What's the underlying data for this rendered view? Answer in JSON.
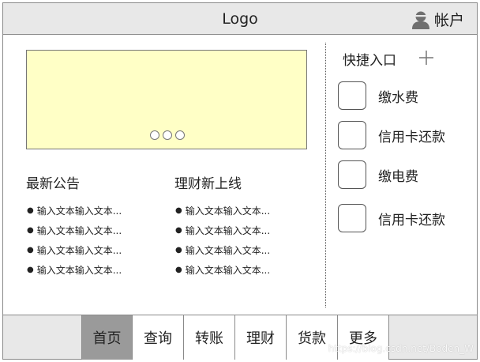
{
  "header": {
    "logo": "Logo",
    "account_label": "帐户",
    "account_icon": "user-icon"
  },
  "banner": {
    "indicator_count": 3
  },
  "news": {
    "title": "最新公告",
    "items": [
      "输入文本输入文本...",
      "输入文本输入文本...",
      "输入文本输入文本...",
      "输入文本输入文本..."
    ]
  },
  "finance": {
    "title": "理财新上线",
    "items": [
      "输入文本输入文本...",
      "输入文本输入文本...",
      "输入文本输入文本...",
      "输入文本输入文本..."
    ]
  },
  "quick": {
    "title": "快捷入口",
    "add_icon": "plus-icon",
    "items": [
      {
        "label": "缴水费"
      },
      {
        "label": "信用卡还款"
      },
      {
        "label": "缴电费"
      },
      {
        "label": "信用卡还款"
      }
    ]
  },
  "nav": {
    "tabs": [
      {
        "label": "首页",
        "active": true
      },
      {
        "label": "查询",
        "active": false
      },
      {
        "label": "转账",
        "active": false
      },
      {
        "label": "理财",
        "active": false
      },
      {
        "label": "货款",
        "active": false
      },
      {
        "label": "更多",
        "active": false
      }
    ]
  },
  "watermark": "https://blog.csdn.net/Boden_W",
  "colors": {
    "banner_bg": "#ffffc6",
    "chrome_bg": "#e8e8e8",
    "active_tab": "#9a9a9a"
  }
}
